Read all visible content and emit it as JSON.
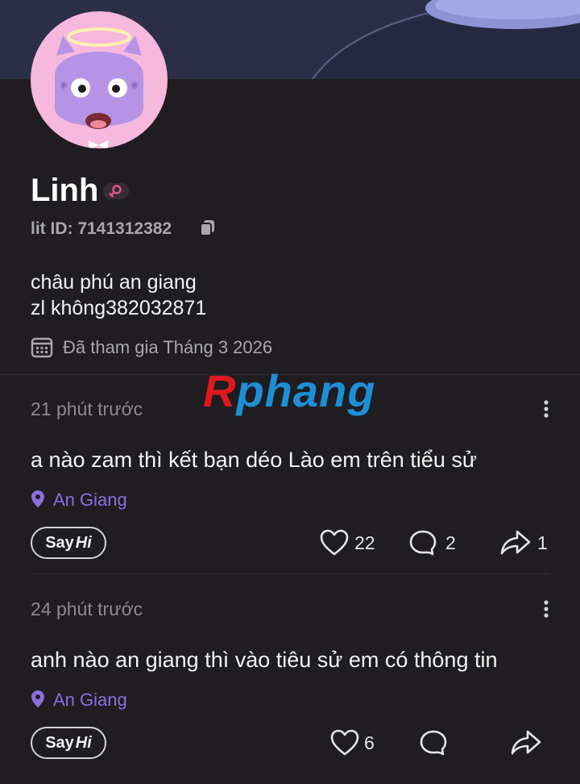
{
  "profile": {
    "name": "Linh",
    "lit_id": "lit ID: 7141312382",
    "bio_line1": "châu phú an giang",
    "bio_line2": "zl không382032871",
    "joined": "Đã tham gia Tháng 3 2026"
  },
  "watermark": {
    "r": "R",
    "rest": "phang"
  },
  "posts": [
    {
      "time": "21 phút trước",
      "text": "a nào zam thì kết bạn déo Lào em trên tiểu sử",
      "location": "An Giang",
      "sayhi_say": "Say",
      "sayhi_hi": "Hi",
      "likes": "22",
      "comments": "2",
      "shares": "1"
    },
    {
      "time": "24 phút trước",
      "text": "anh nào an giang thì vào tiêu sử em có thông tin",
      "location": "An Giang",
      "sayhi_say": "Say",
      "sayhi_hi": "Hi",
      "likes": "6"
    }
  ],
  "colors": {
    "background": "#1f1d21",
    "location_accent": "#8b6fe0",
    "avatar_bg": "#f6b8dd",
    "gender_badge": "#e05a8a"
  }
}
